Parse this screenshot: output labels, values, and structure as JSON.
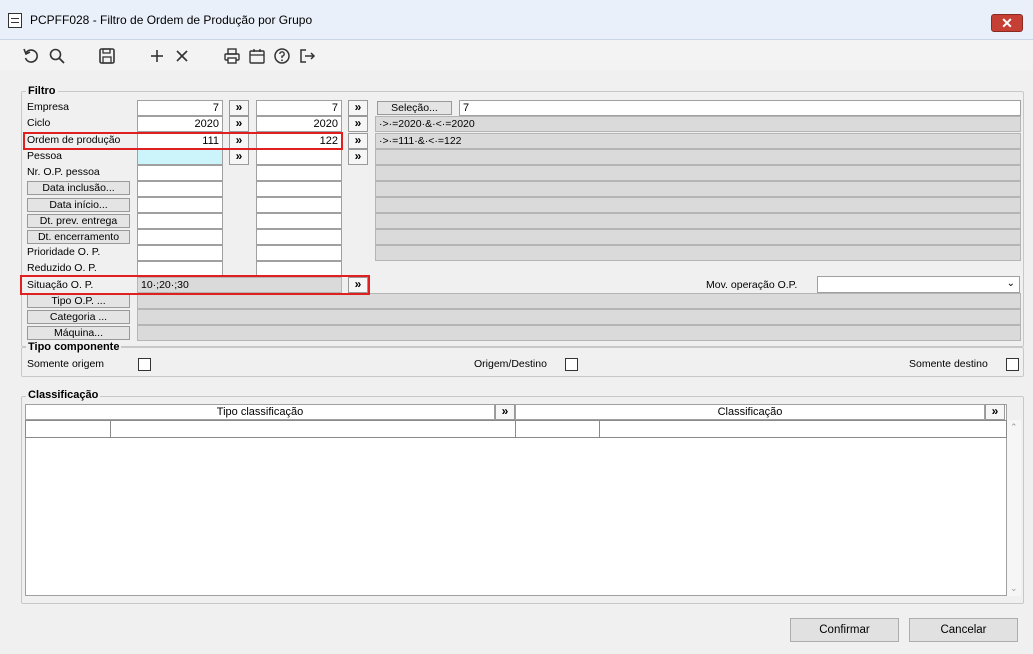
{
  "window": {
    "title": "PCPFF028 - Filtro de Ordem de Produção por Grupo",
    "close_label": "✕"
  },
  "filtro": {
    "title": "Filtro",
    "rows": [
      {
        "label": "Empresa",
        "from": "7",
        "to": "7"
      },
      {
        "label": "Ciclo",
        "from": "2020",
        "to": "2020",
        "expr": "·>·=2020·&·<·=2020"
      },
      {
        "label": "Ordem de produção",
        "from": "111",
        "to": "122",
        "expr": "·>·=111·&·<·=122"
      },
      {
        "label": "Pessoa",
        "from": "",
        "to": ""
      },
      {
        "label": "Nr. O.P. pessoa"
      },
      {
        "label": "Data inclusão..."
      },
      {
        "label": "Data início..."
      },
      {
        "label": "Dt. prev. entrega"
      },
      {
        "label": "Dt. encerramento"
      },
      {
        "label": "Prioridade O. P."
      },
      {
        "label": "Reduzido O. P."
      }
    ],
    "selecao_label": "Seleção...",
    "selecao_value": "7",
    "situacao_label": "Situação O. P.",
    "situacao_value": "10·;20·;30",
    "mov_label": "Mov. operação O.P.",
    "mov_value": "",
    "tipo_op_label": "Tipo O.P. ...",
    "categoria_label": "Categoria ...",
    "maquina_label": "Máquina...",
    "arrow": "»"
  },
  "tipo_componente": {
    "title": "Tipo componente",
    "somente_origem": "Somente origem",
    "origem_destino": "Origem/Destino",
    "somente_destino": "Somente destino"
  },
  "classificacao": {
    "title": "Classificação",
    "col_tipo": "Tipo classificação",
    "col_class": "Classificação"
  },
  "buttons": {
    "confirmar": "Confirmar",
    "cancelar": "Cancelar"
  }
}
